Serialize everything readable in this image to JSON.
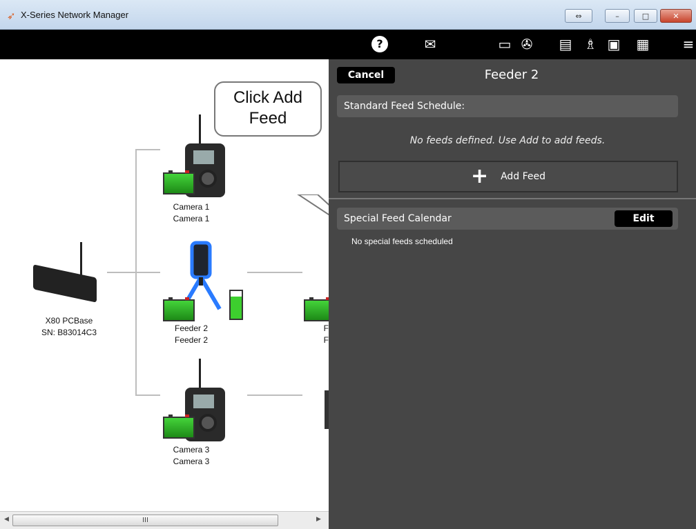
{
  "window": {
    "title": "X-Series Network Manager",
    "controls": {
      "swap": "⇔",
      "minimize": "–",
      "maximize": "□",
      "close": "✕"
    }
  },
  "toolbar": {
    "icons": [
      "help-icon",
      "mail-icon",
      "monitor-icon",
      "film-icon",
      "chart-icon",
      "network-icon",
      "layout-icon",
      "grid-icon",
      "menu-icon"
    ],
    "help_glyph": "?"
  },
  "diagram": {
    "base": {
      "name": "X80 PCBase",
      "sn": "SN: B83014C3"
    },
    "devices": [
      {
        "line1": "Camera 1",
        "line2": "Camera 1"
      },
      {
        "line1": "Feeder 2",
        "line2": "Feeder 2"
      },
      {
        "line1": "Camera 3",
        "line2": "Camera 3"
      }
    ],
    "partial_device": {
      "line1": "F",
      "line2": "F"
    },
    "callout": "Click Add Feed",
    "scroll_grip": "III"
  },
  "panel": {
    "cancel_label": "Cancel",
    "title": "Feeder 2",
    "standard_header": "Standard Feed Schedule:",
    "empty_message": "No feeds defined. Use Add to add feeds.",
    "add_feed_label": "Add Feed",
    "add_feed_icon": "+",
    "special_header": "Special Feed Calendar",
    "edit_label": "Edit",
    "no_special": "No special feeds scheduled"
  },
  "colors": {
    "panel_bg": "#464646",
    "toolbar_bg": "#000000",
    "battery_green": "#2fb824",
    "feeder_glow": "#1e6bff"
  }
}
